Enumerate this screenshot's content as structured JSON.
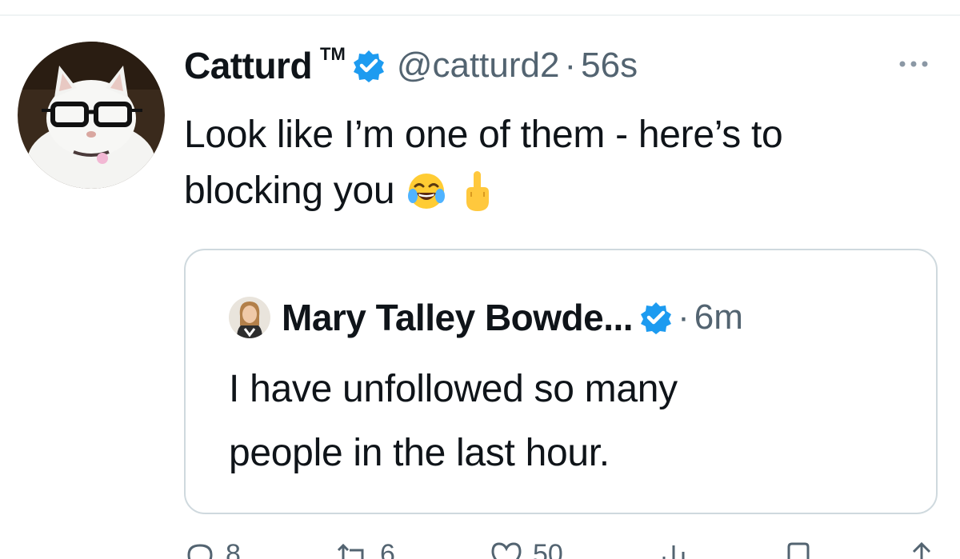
{
  "tweet": {
    "author": {
      "display_name": "Catturd",
      "trademark": "TM",
      "handle": "@catturd2",
      "verified": true,
      "avatar_icon": "cat-with-glasses-avatar"
    },
    "separator": "·",
    "time_ago": "56s",
    "text_line1": "Look like I’m one of them - here’s to",
    "text_line2": "blocking you",
    "emojis": [
      "face-with-tears-of-joy-emoji",
      "middle-finger-emoji"
    ],
    "more_icon": "more-dots-icon",
    "quoted": {
      "display_name": "Mary Talley Bowde...",
      "verified": true,
      "separator": "·",
      "time_ago": "6m",
      "text_line1": "I have unfollowed so many",
      "text_line2": "people in the last hour.",
      "avatar_icon": "woman-portrait-avatar"
    },
    "actions": [
      {
        "icon": "reply-icon",
        "count": "8"
      },
      {
        "icon": "retweet-icon",
        "count": "6"
      },
      {
        "icon": "like-icon",
        "count": "50"
      },
      {
        "icon": "views-icon",
        "count": ""
      },
      {
        "icon": "bookmark-icon",
        "count": ""
      },
      {
        "icon": "share-icon",
        "count": ""
      }
    ]
  },
  "colors": {
    "text": "#0f1419",
    "secondary": "#536471",
    "verified_blue": "#1d9bf0",
    "border": "#cfd9de"
  }
}
